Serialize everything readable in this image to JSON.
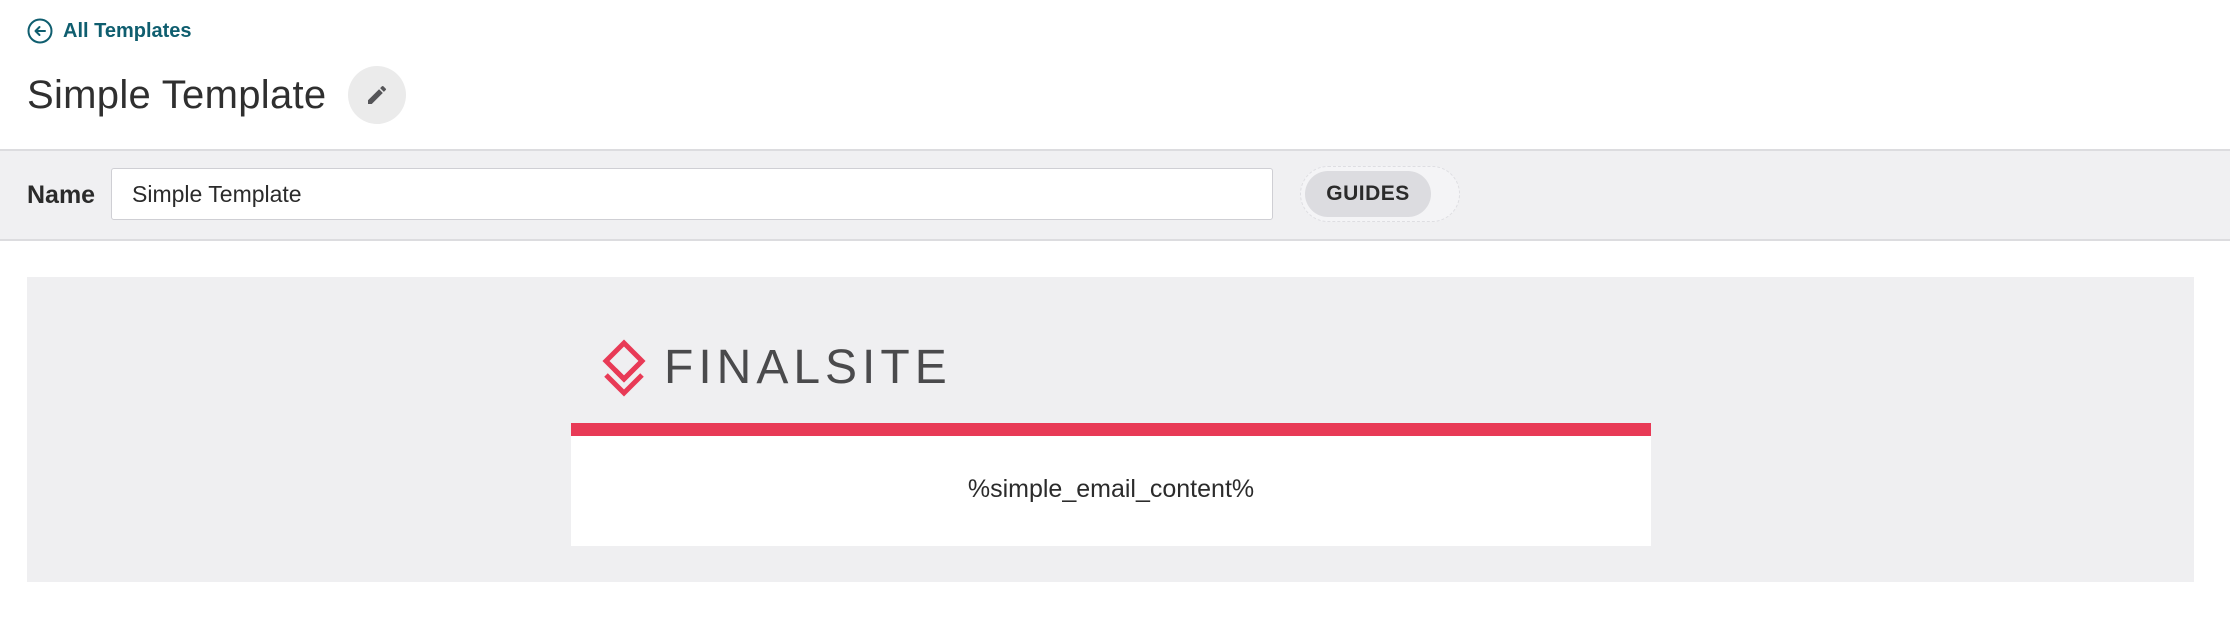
{
  "nav": {
    "back_label": "All Templates",
    "back_icon": "arrow-left-circle-icon"
  },
  "header": {
    "title": "Simple Template",
    "edit_icon": "pencil-icon"
  },
  "toolbar": {
    "name_label": "Name",
    "name_value": "Simple Template",
    "guides_label": "GUIDES"
  },
  "preview": {
    "logo_text": "FINALSITE",
    "logo_icon": "finalsite-logo-mark",
    "body_text": "%simple_email_content%"
  },
  "colors": {
    "link": "#0f5e6f",
    "accent": "#e83a56",
    "toolbar_bg": "#f0f0f2",
    "preview_bg": "#efeff1"
  }
}
